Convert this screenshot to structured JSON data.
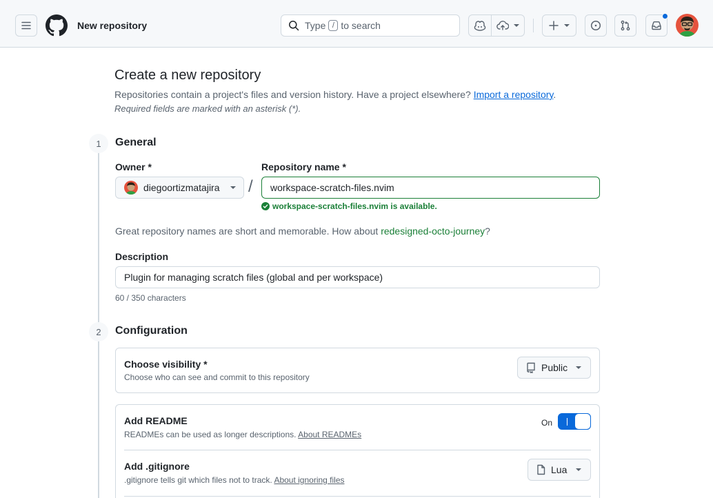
{
  "header": {
    "page_context": "New repository",
    "search": {
      "pre": "Type",
      "key": "/",
      "post": "to search"
    }
  },
  "page": {
    "title": "Create a new repository",
    "subtitle": "Repositories contain a project's files and version history. Have a project elsewhere?",
    "import_link": "Import a repository",
    "subtitle_end": ".",
    "required_note": "Required fields are marked with an asterisk (*)."
  },
  "general": {
    "step": "1",
    "title": "General",
    "owner_label": "Owner *",
    "owner_value": "diegoortizmatajira",
    "slash": "/",
    "repo_label": "Repository name *",
    "repo_value": "workspace-scratch-files.nvim",
    "availability": "workspace-scratch-files.nvim is available.",
    "suggest_text": "Great repository names are short and memorable. How about",
    "suggest_name": "redesigned-octo-journey",
    "suggest_end": "?",
    "description_label": "Description",
    "description_value": "Plugin for managing scratch files (global and per workspace)",
    "char_count": "60 / 350 characters"
  },
  "configuration": {
    "step": "2",
    "title": "Configuration",
    "visibility": {
      "title": "Choose visibility *",
      "subtitle": "Choose who can see and commit to this repository",
      "value": "Public"
    },
    "readme": {
      "title": "Add README",
      "subtitle": "READMEs can be used as longer descriptions.",
      "link": "About READMEs",
      "toggle_label": "On",
      "enabled": true
    },
    "gitignore": {
      "title": "Add .gitignore",
      "subtitle": ".gitignore tells git which files not to track.",
      "link": "About ignoring files",
      "value": "Lua"
    }
  },
  "colors": {
    "accent": "#0969da",
    "success": "#1a7f37",
    "border": "#d1d9e0",
    "muted": "#59636e"
  }
}
